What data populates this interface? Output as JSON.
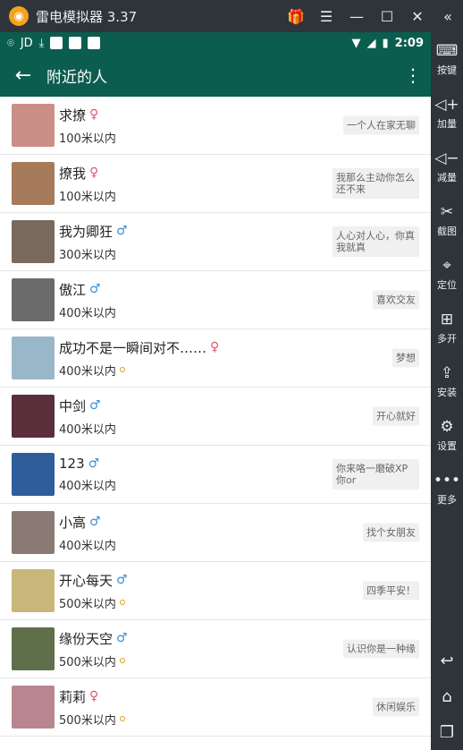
{
  "emulator": {
    "title": "雷电模拟器 3.37",
    "controls": [
      "gift-icon",
      "menu-icon",
      "minimize-icon",
      "maximize-icon",
      "close-icon",
      "collapse-icon"
    ]
  },
  "statusbar": {
    "carrier": "JD",
    "time": "2:09"
  },
  "appbar": {
    "title": "附近的人"
  },
  "people": [
    {
      "name": "求撩",
      "gender": "♀",
      "gender_type": "female",
      "distance": "100米以内",
      "online": false,
      "signature": "一个人在家无聊",
      "avatar_color": "#c98f86"
    },
    {
      "name": "撩我",
      "gender": "♀",
      "gender_type": "female",
      "distance": "100米以内",
      "online": false,
      "signature": "我那么主动你怎么还不来",
      "avatar_color": "#a67a5a"
    },
    {
      "name": "我为卿狂",
      "gender": "♂",
      "gender_type": "male",
      "distance": "300米以内",
      "online": false,
      "signature": "人心对人心，你真我就真",
      "avatar_color": "#7a6a5e"
    },
    {
      "name": "傲江",
      "gender": "♂",
      "gender_type": "male",
      "distance": "400米以内",
      "online": false,
      "signature": "喜欢交友",
      "avatar_color": "#6b6b6b"
    },
    {
      "name": "成功不是一瞬间对不……",
      "gender": "♀",
      "gender_type": "female",
      "distance": "400米以内",
      "online": true,
      "signature": "梦想",
      "avatar_color": "#9ab7c9"
    },
    {
      "name": "中剑",
      "gender": "♂",
      "gender_type": "male",
      "distance": "400米以内",
      "online": false,
      "signature": "开心就好",
      "avatar_color": "#5a2e3a"
    },
    {
      "name": "123",
      "gender": "♂",
      "gender_type": "male",
      "distance": "400米以内",
      "online": false,
      "signature": "你来咯一磨破XP你or",
      "avatar_color": "#2f5d9a"
    },
    {
      "name": "小高",
      "gender": "♂",
      "gender_type": "male",
      "distance": "400米以内",
      "online": false,
      "signature": "找个女朋友",
      "avatar_color": "#8a7a74"
    },
    {
      "name": "开心每天",
      "gender": "♂",
      "gender_type": "male",
      "distance": "500米以内",
      "online": true,
      "signature": "四季平安！",
      "avatar_color": "#c9b77a"
    },
    {
      "name": "缘份天空",
      "gender": "♂",
      "gender_type": "male",
      "distance": "500米以内",
      "online": true,
      "signature": "认识你是一种缘",
      "avatar_color": "#5f6e4b"
    },
    {
      "name": "莉莉",
      "gender": "♀",
      "gender_type": "female",
      "distance": "500米以内",
      "online": true,
      "signature": "休闲娱乐",
      "avatar_color": "#b8868e"
    }
  ],
  "sidebar": [
    {
      "label": "按键",
      "icon": "keyboard-icon",
      "glyph": "⌨"
    },
    {
      "label": "加量",
      "icon": "volume-up-icon",
      "glyph": "◁+"
    },
    {
      "label": "减量",
      "icon": "volume-down-icon",
      "glyph": "◁−"
    },
    {
      "label": "截图",
      "icon": "scissors-icon",
      "glyph": "✂"
    },
    {
      "label": "定位",
      "icon": "location-icon",
      "glyph": "⌖"
    },
    {
      "label": "多开",
      "icon": "multi-open-icon",
      "glyph": "⊞"
    },
    {
      "label": "安装",
      "icon": "apk-install-icon",
      "glyph": "⇪"
    },
    {
      "label": "设置",
      "icon": "settings-icon",
      "glyph": "⚙"
    },
    {
      "label": "更多",
      "icon": "more-icon",
      "glyph": "•••"
    }
  ],
  "nav_buttons": [
    {
      "icon": "back-nav-icon",
      "glyph": "↩"
    },
    {
      "icon": "home-icon",
      "glyph": "⌂"
    },
    {
      "icon": "recents-icon",
      "glyph": "❐"
    }
  ]
}
